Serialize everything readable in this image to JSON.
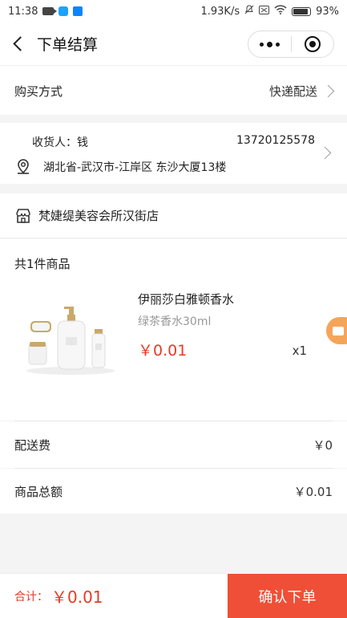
{
  "status_bar": {
    "time": "11:38",
    "net_speed": "1.93K/s",
    "battery": "93%"
  },
  "nav": {
    "title": "下单结算"
  },
  "purchase": {
    "label": "购买方式",
    "value": "快递配送"
  },
  "address": {
    "name": "收货人：钱",
    "phone": "13720125578",
    "detail": "湖北省-武汉市-江岸区 东沙大厦13楼"
  },
  "store": {
    "name": "梵婕缇美容会所汉街店"
  },
  "goods": {
    "count_label": "共1件商品",
    "item": {
      "name": "伊丽莎白雅顿香水",
      "spec": "绿茶香水30ml",
      "price": "￥0.01",
      "qty": "x1"
    }
  },
  "fees": {
    "shipping_label": "配送费",
    "shipping_value": "￥0",
    "subtotal_label": "商品总额",
    "subtotal_value": "￥0.01"
  },
  "footer": {
    "total_label": "合计：",
    "total_value": "￥0.01",
    "confirm_label": "确认下单"
  },
  "colors": {
    "accent": "#ef4f36",
    "price": "#e93a24"
  },
  "icons": [
    "back-icon",
    "more-icon",
    "close-mini-program-icon",
    "location-pin-icon",
    "store-icon",
    "chevron-right-icon",
    "video-call-icon"
  ]
}
